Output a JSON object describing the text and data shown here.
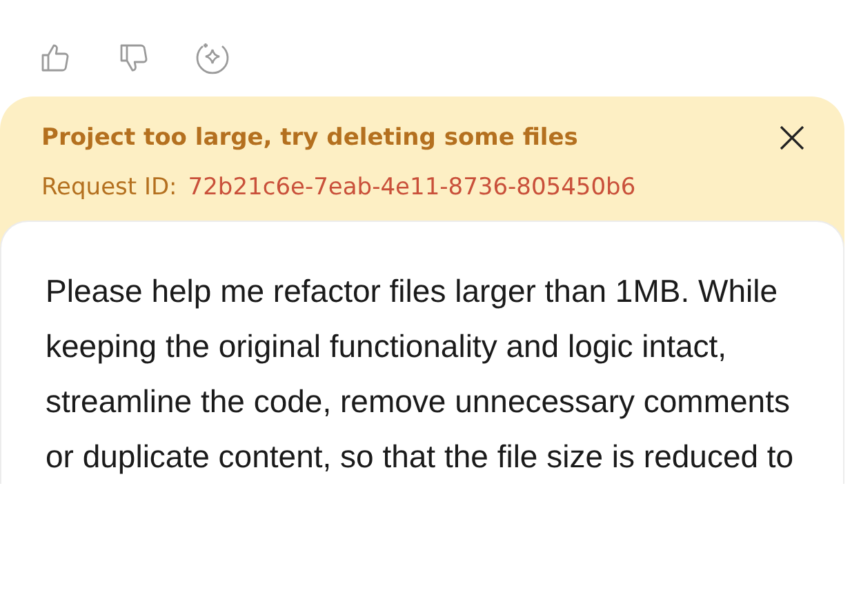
{
  "feedback": {
    "actions": [
      {
        "kind": "like"
      },
      {
        "kind": "dislike"
      },
      {
        "kind": "ai"
      }
    ]
  },
  "error_banner": {
    "title": "Project too large, try deleting some files",
    "request_label": "Request ID:",
    "request_id": "72b21c6e-7eab-4e11-8736-805450b6"
  },
  "message": {
    "text": "Please help me refactor files larger than 1MB. While keeping the original functionality and logic intact, streamline the code, remove unnecessary comments or duplicate content, so that the file size is reduced to"
  }
}
